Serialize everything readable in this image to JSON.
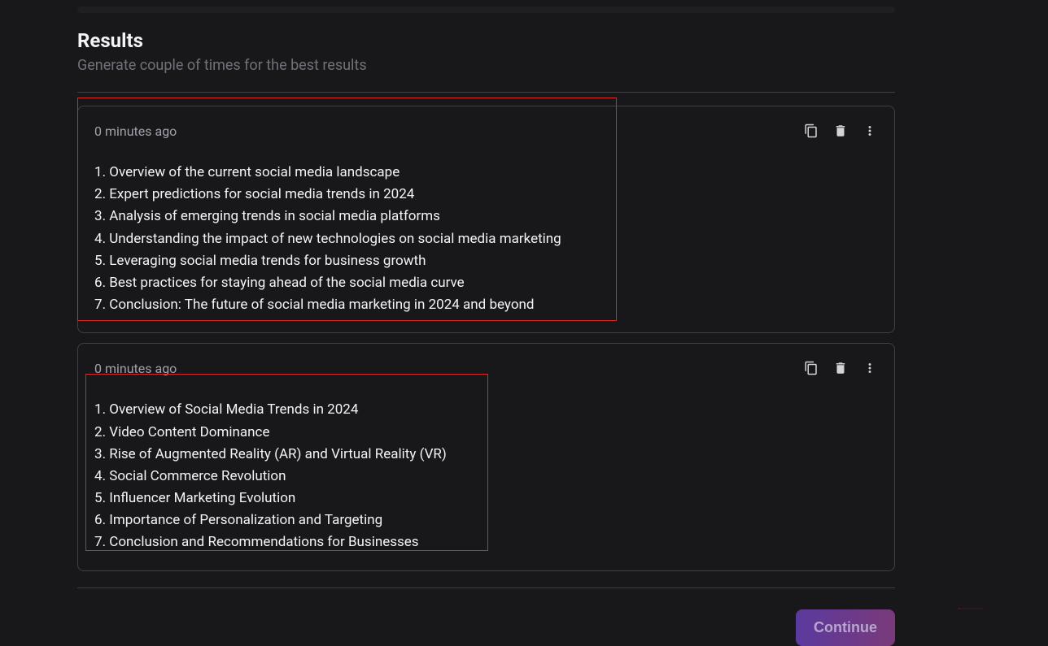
{
  "header": {
    "title": "Results",
    "subtitle": "Generate couple of times for the best results"
  },
  "results": [
    {
      "timestamp": "0 minutes ago",
      "items": [
        "Overview of the current social media landscape",
        "Expert predictions for social media trends in 2024",
        "Analysis of emerging trends in social media platforms",
        "Understanding the impact of new technologies on social media marketing",
        "Leveraging social media trends for business growth",
        "Best practices for staying ahead of the social media curve",
        "Conclusion: The future of social media marketing in 2024 and beyond"
      ]
    },
    {
      "timestamp": "0 minutes ago",
      "items": [
        "Overview of Social Media Trends in 2024",
        "Video Content Dominance",
        "Rise of Augmented Reality (AR) and Virtual Reality (VR)",
        "Social Commerce Revolution",
        "Influencer Marketing Evolution",
        "Importance of Personalization and Targeting",
        "Conclusion and Recommendations for Businesses"
      ]
    }
  ],
  "footer": {
    "continue_label": "Continue"
  }
}
